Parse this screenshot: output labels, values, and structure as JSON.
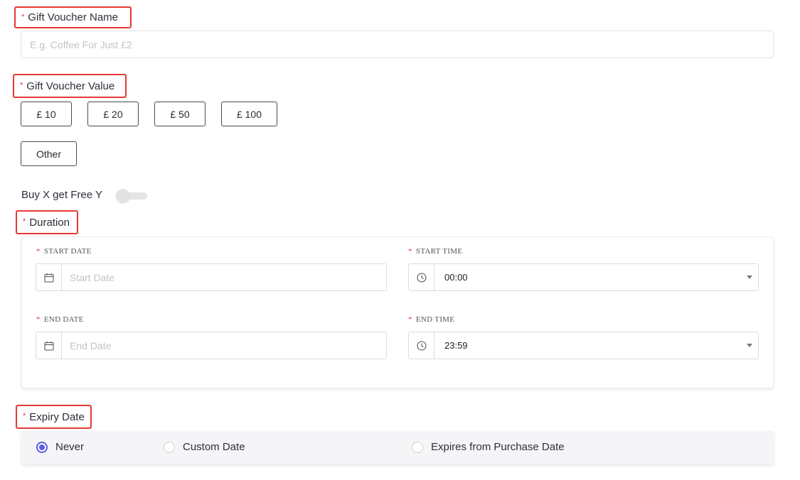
{
  "voucher_name": {
    "label": "Gift Voucher Name",
    "placeholder": "E.g. Coffee For Just £2",
    "value": ""
  },
  "voucher_value": {
    "label": "Gift Voucher Value",
    "options": [
      "£ 10",
      "£ 20",
      "£ 50",
      "£ 100"
    ],
    "other_label": "Other"
  },
  "buy_x_get_y": {
    "label": "Buy X get Free Y",
    "enabled": false
  },
  "duration": {
    "label": "Duration",
    "start_date": {
      "label": "START DATE",
      "placeholder": "Start Date",
      "icon": "calendar-icon"
    },
    "start_time": {
      "label": "START TIME",
      "value": "00:00",
      "icon": "clock-icon"
    },
    "end_date": {
      "label": "END DATE",
      "placeholder": "End Date",
      "icon": "calendar-icon"
    },
    "end_time": {
      "label": "END TIME",
      "value": "23:59",
      "icon": "clock-icon"
    }
  },
  "expiry": {
    "label": "Expiry Date",
    "options": [
      "Never",
      "Custom Date",
      "Expires from Purchase Date"
    ],
    "selected": "Never"
  },
  "required_marker": "*",
  "colors": {
    "required": "#e53935",
    "annotation_outline": "#e53935",
    "radio_accent": "#5a5de8"
  }
}
